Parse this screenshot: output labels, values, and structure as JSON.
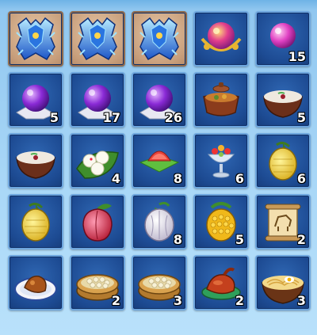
{
  "inventory": {
    "rows": [
      [
        {
          "icon": "blue-crystal-armor-icon",
          "qty": "",
          "equipped": true
        },
        {
          "icon": "blue-crystal-armor-icon",
          "qty": "",
          "equipped": true
        },
        {
          "icon": "blue-crystal-armor-icon",
          "qty": "",
          "equipped": true
        },
        {
          "icon": "golden-magic-orb-icon",
          "qty": "",
          "equipped": false
        },
        {
          "icon": "pink-pearl-icon",
          "qty": "15",
          "equipped": false
        }
      ],
      [
        {
          "icon": "purple-spirit-orb-icon",
          "qty": "5",
          "equipped": false
        },
        {
          "icon": "purple-spirit-orb-icon",
          "qty": "17",
          "equipped": false
        },
        {
          "icon": "purple-spirit-orb-icon",
          "qty": "26",
          "equipped": false
        },
        {
          "icon": "stew-pot-icon",
          "qty": "",
          "equipped": false
        },
        {
          "icon": "porridge-bowl-icon",
          "qty": "5",
          "equipped": false
        }
      ],
      [
        {
          "icon": "porridge-bowl-icon",
          "qty": "",
          "equipped": false
        },
        {
          "icon": "rice-balls-leaf-icon",
          "qty": "4",
          "equipped": false
        },
        {
          "icon": "fruit-salad-icon",
          "qty": "8",
          "equipped": false
        },
        {
          "icon": "fruit-goblet-icon",
          "qty": "6",
          "equipped": false
        },
        {
          "icon": "yellow-lemon-fruit-icon",
          "qty": "6",
          "equipped": false
        }
      ],
      [
        {
          "icon": "yellow-lemon-fruit-icon",
          "qty": "",
          "equipped": false
        },
        {
          "icon": "peach-icon",
          "qty": "",
          "equipped": false
        },
        {
          "icon": "white-fruit-icon",
          "qty": "8",
          "equipped": false
        },
        {
          "icon": "golden-corn-fruit-icon",
          "qty": "5",
          "equipped": false
        },
        {
          "icon": "scroll-map-icon",
          "qty": "2",
          "equipped": false
        }
      ],
      [
        {
          "icon": "roast-chicken-plate-icon",
          "qty": "",
          "equipped": false
        },
        {
          "icon": "dumpling-steamer-icon",
          "qty": "2",
          "equipped": false
        },
        {
          "icon": "dumpling-steamer-icon",
          "qty": "3",
          "equipped": false
        },
        {
          "icon": "roast-duck-icon",
          "qty": "2",
          "equipped": false
        },
        {
          "icon": "noodle-bowl-icon",
          "qty": "3",
          "equipped": false
        }
      ]
    ]
  },
  "colors": {
    "slot_bg": "#1d4b93",
    "slot_border": "#6ea6de",
    "equipped_bg": "#c89f7c",
    "equipped_border": "#8f6a4d",
    "qty_text": "#ffffff"
  }
}
